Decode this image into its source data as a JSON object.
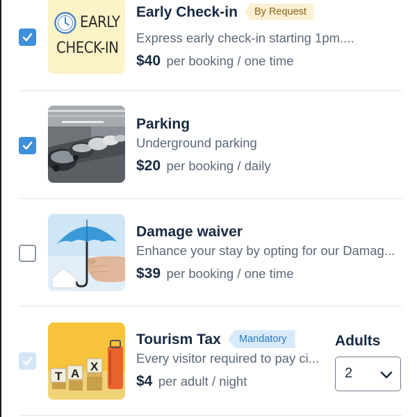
{
  "addons": [
    {
      "title": "Early Check-in",
      "badge": "By Request",
      "description": "Express early check-in starting 1pm....",
      "price": "$40",
      "unit": "per booking / one time",
      "checked": true,
      "thumb_text_line1": "EARLY",
      "thumb_text_line2": "CHECK-IN"
    },
    {
      "title": "Parking",
      "description": "Underground parking",
      "price": "$20",
      "unit": "per booking / daily",
      "checked": true
    },
    {
      "title": "Damage waiver",
      "description": "Enhance your stay by opting for our Damag...",
      "price": "$39",
      "unit": "per booking / one time",
      "checked": false
    },
    {
      "title": "Tourism Tax",
      "badge": "Mandatory",
      "description": "Every visitor required to pay ci...",
      "price": "$4",
      "unit": "per adult / night",
      "checked": true,
      "disabled": true,
      "thumb_text": "TAX",
      "quantity_label": "Adults",
      "quantity_value": "2"
    }
  ],
  "colors": {
    "checkbox_checked": "#3f8fdc",
    "checkbox_disabled": "#d4e5f6",
    "badge_request_bg": "#fdf1d4",
    "badge_mandatory_bg": "#d8eafa",
    "title": "#172a42"
  },
  "icons": {
    "checkmark": "check-icon",
    "clock": "clock-icon",
    "select_chevron": "chevron-down-icon"
  }
}
